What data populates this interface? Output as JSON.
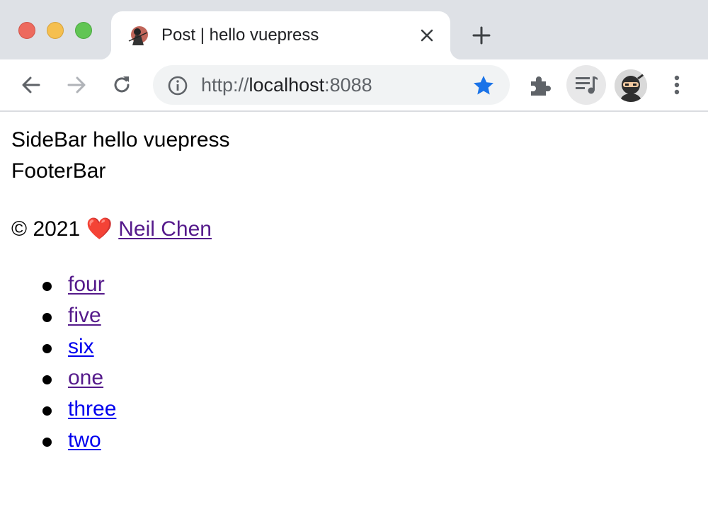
{
  "browser": {
    "tab": {
      "title": "Post | hello vuepress"
    },
    "address_bar": {
      "scheme": "http://",
      "host": "localhost",
      "port": ":8088"
    },
    "icons": {
      "back": "arrow-left-icon",
      "forward": "arrow-right-icon",
      "reload": "reload-icon",
      "info": "info-icon",
      "bookmark": "star-icon",
      "extensions": "puzzle-icon",
      "media": "media-control-icon",
      "profile": "avatar",
      "menu": "kebab-menu-icon"
    },
    "accent_color": "#1a73e8"
  },
  "page": {
    "sidebar_text": "SideBar hello vuepress",
    "footer_text": "FooterBar",
    "copyright": {
      "prefix": "© 2021",
      "heart": "❤️",
      "author_link": "Neil Chen"
    },
    "links": [
      {
        "label": "four",
        "visited": true
      },
      {
        "label": "five",
        "visited": true
      },
      {
        "label": "six",
        "visited": false
      },
      {
        "label": "one",
        "visited": true
      },
      {
        "label": "three",
        "visited": false
      },
      {
        "label": "two",
        "visited": false
      }
    ],
    "colors": {
      "visited_link": "#551a8b",
      "unvisited_link": "#0000ee"
    }
  }
}
